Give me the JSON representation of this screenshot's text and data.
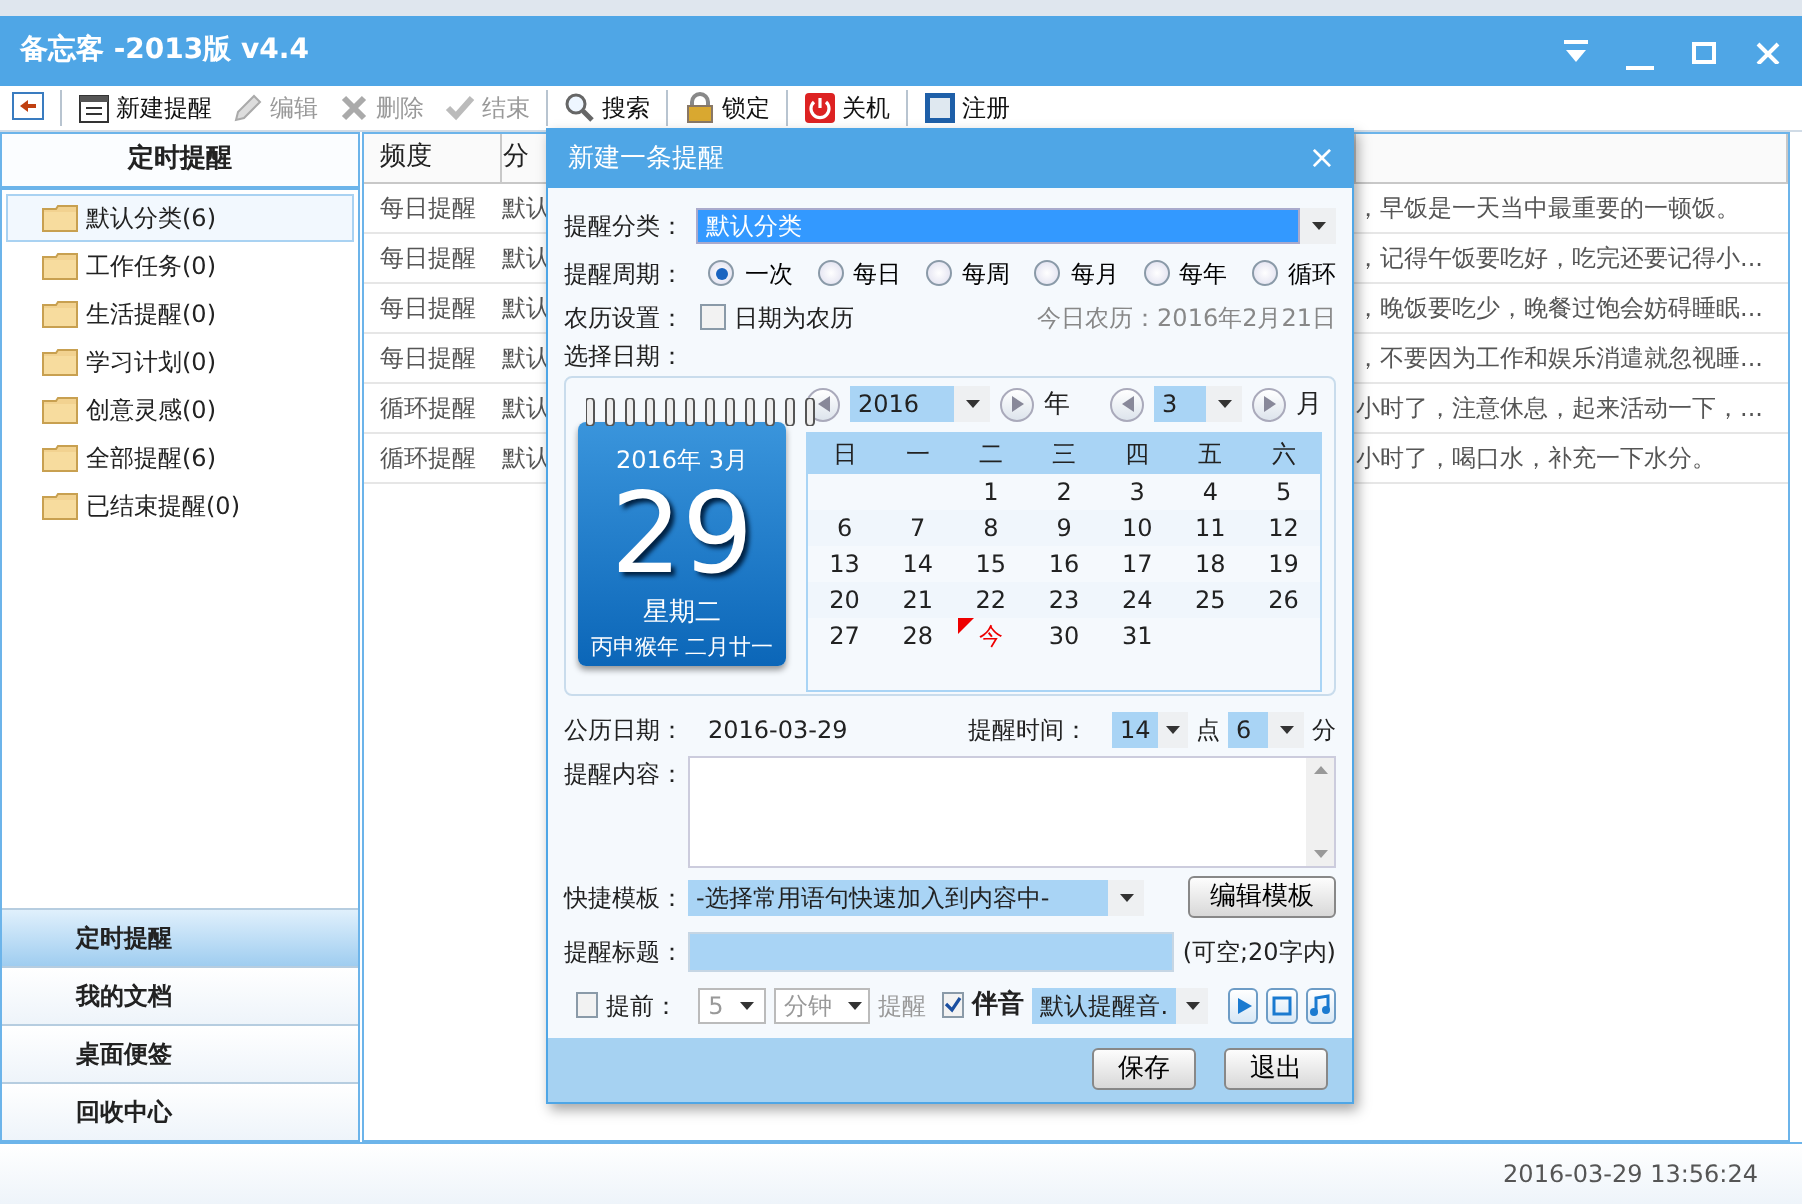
{
  "window": {
    "title": "备忘客 -2013版 v4.4"
  },
  "toolbar": [
    {
      "disabled": false,
      "separator_after": true
    },
    {
      "label": "新建提醒",
      "disabled": false,
      "separator_after": false
    },
    {
      "label": "编辑",
      "disabled": true,
      "separator_after": false
    },
    {
      "label": "删除",
      "disabled": true,
      "separator_after": false
    },
    {
      "label": "结束",
      "disabled": true,
      "separator_after": true
    },
    {
      "label": "搜索",
      "disabled": false,
      "separator_after": true
    },
    {
      "label": "锁定",
      "disabled": false,
      "separator_after": true
    },
    {
      "label": "关机",
      "disabled": false,
      "separator_after": true
    },
    {
      "label": "注册",
      "disabled": false,
      "separator_after": false
    }
  ],
  "sidebar": {
    "header": "定时提醒",
    "items": [
      {
        "label": "默认分类(6)",
        "selected": true
      },
      {
        "label": "工作任务(0)",
        "selected": false
      },
      {
        "label": "生活提醒(0)",
        "selected": false
      },
      {
        "label": "学习计划(0)",
        "selected": false
      },
      {
        "label": "创意灵感(0)",
        "selected": false
      },
      {
        "label": "全部提醒(6)",
        "selected": false
      },
      {
        "label": "已结束提醒(0)",
        "selected": false
      }
    ],
    "nav": [
      {
        "label": "定时提醒",
        "selected": true
      },
      {
        "label": "我的文档",
        "selected": false
      },
      {
        "label": "桌面便签",
        "selected": false
      },
      {
        "label": "回收中心",
        "selected": false
      }
    ]
  },
  "table": {
    "columns": [
      "频度",
      "分"
    ],
    "rows": [
      {
        "column_1": "每日提醒",
        "column_2": "默认",
        "column_3": "，早饭是一天当中最重要的一顿饭。"
      },
      {
        "column_1": "每日提醒",
        "column_2": "默认",
        "column_3": "，记得午饭要吃好，吃完还要记得小..."
      },
      {
        "column_1": "每日提醒",
        "column_2": "默认",
        "column_3": "，晚饭要吃少，晚餐过饱会妨碍睡眠..."
      },
      {
        "column_1": "每日提醒",
        "column_2": "默认",
        "column_3": "，不要因为工作和娱乐消遣就忽视睡..."
      },
      {
        "column_1": "循环提醒",
        "column_2": "默认",
        "column_3": "小时了，注意休息，起来活动一下，..."
      },
      {
        "column_1": "循环提醒",
        "column_2": "默认",
        "column_3": "小时了，喝口水，补充一下水分。"
      }
    ]
  },
  "status_bar": {
    "datetime": "2016-03-29 13:56:24"
  },
  "dialog": {
    "title": "新建一条提醒",
    "close": "×",
    "category": {
      "label": "提醒分类：",
      "value": "默认分类"
    },
    "period": {
      "label": "提醒周期：",
      "options": [
        {
          "label": "一次",
          "selected": true
        },
        {
          "label": "每日",
          "selected": false
        },
        {
          "label": "每周",
          "selected": false
        },
        {
          "label": "每月",
          "selected": false
        },
        {
          "label": "每年",
          "selected": false
        },
        {
          "label": "循环",
          "selected": false
        }
      ]
    },
    "lunar": {
      "label": "农历设置：",
      "checkbox": "日期为农历",
      "checked": false,
      "today": "今日农历：2016年2月21日"
    },
    "date": {
      "label": "选择日期：",
      "card": {
        "month": "2016年  3月",
        "day": "29",
        "weekday": "星期二",
        "lunar": "丙申猴年  二月廿一"
      },
      "year": "2016",
      "year_unit": "年",
      "month": "3",
      "month_unit": "月",
      "weekdays": [
        "日",
        "一",
        "二",
        "三",
        "四",
        "五",
        "六"
      ],
      "weeks": [
        [
          {
            "text": "1",
            "selected": false
          },
          {
            "text": "2",
            "selected": false
          },
          {
            "text": "3",
            "selected": false
          },
          {
            "text": "4",
            "selected": false
          },
          {
            "text": "5",
            "selected": false
          }
        ],
        [
          {
            "text": "6",
            "selected": false
          },
          {
            "text": "7",
            "selected": false
          },
          {
            "text": "8",
            "selected": false
          },
          {
            "text": "9",
            "selected": false
          },
          {
            "text": "10",
            "selected": false
          },
          {
            "text": "11",
            "selected": false
          },
          {
            "text": "12",
            "selected": false
          }
        ],
        [
          {
            "text": "13",
            "selected": false
          },
          {
            "text": "14",
            "selected": false
          },
          {
            "text": "15",
            "selected": false
          },
          {
            "text": "16",
            "selected": false
          },
          {
            "text": "17",
            "selected": false
          },
          {
            "text": "18",
            "selected": false
          },
          {
            "text": "19",
            "selected": false
          }
        ],
        [
          {
            "text": "20",
            "selected": false
          },
          {
            "text": "21",
            "selected": false
          },
          {
            "text": "22",
            "selected": false
          },
          {
            "text": "23",
            "selected": false
          },
          {
            "text": "24",
            "selected": false
          },
          {
            "text": "25",
            "selected": false
          },
          {
            "text": "26",
            "selected": false
          }
        ],
        [
          {
            "text": "27",
            "selected": false
          },
          {
            "text": "28",
            "selected": false
          },
          {
            "text": "今",
            "selected": true
          },
          {
            "text": "30",
            "selected": false
          },
          {
            "text": "31",
            "selected": false
          }
        ]
      ]
    },
    "gregorian": {
      "label": "公历日期：",
      "value": "2016-03-29"
    },
    "time": {
      "label": "提醒时间：",
      "hour": "14",
      "hour_unit": "点",
      "minute": "6",
      "minute_unit": "分"
    },
    "content": {
      "label": "提醒内容："
    },
    "template": {
      "label": "快捷模板：",
      "value": "-选择常用语句快速加入到内容中-",
      "button": "编辑模板"
    },
    "subject": {
      "label": "提醒标题：",
      "hint": "(可空;20字内)"
    },
    "advance": {
      "checked": false,
      "label": "提前：",
      "amount": "5",
      "unit": "分钟",
      "suffix": "提醒",
      "disabled": true
    },
    "sound": {
      "checked": true,
      "label": "伴音",
      "value": "默认提醒音."
    },
    "buttons": [
      "保存",
      "退出"
    ]
  }
}
